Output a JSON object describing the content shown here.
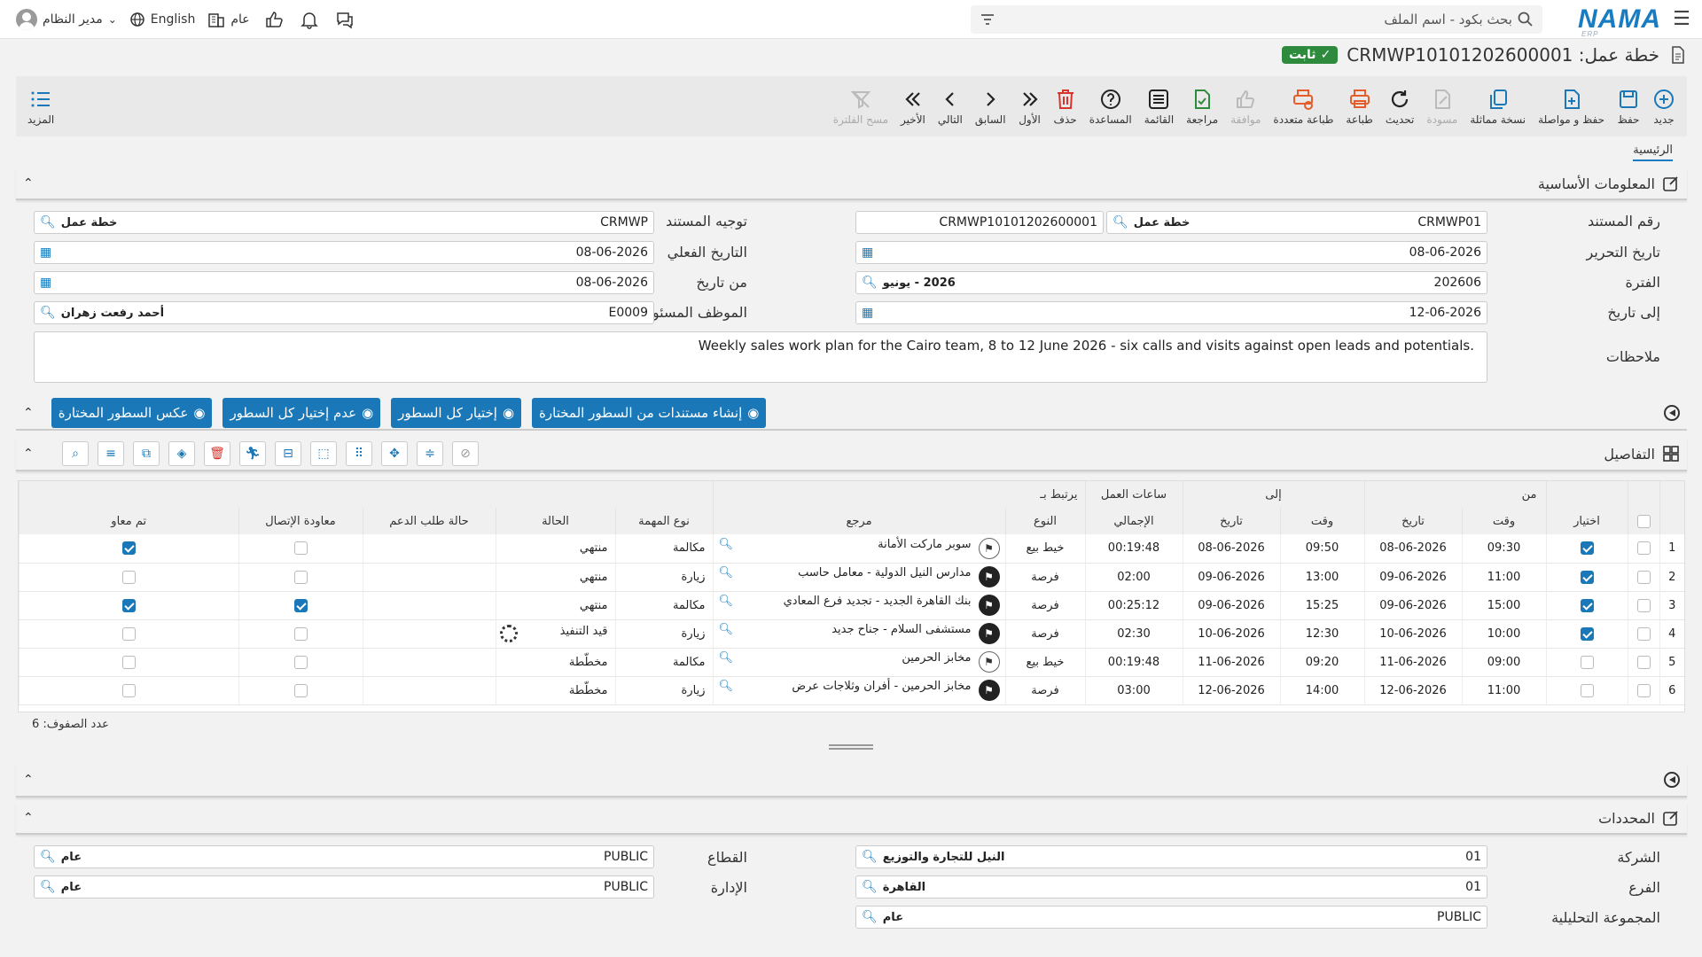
{
  "topbar": {
    "logo": "NAMA",
    "logo_sub": "ERP",
    "search_placeholder": "بحث بكود - اسم الملف",
    "user_name": "مدير النظام",
    "language": "English",
    "scope": "عام"
  },
  "header": {
    "title": "خطة عمل: CRMWP10101202600001",
    "status": "ثابت"
  },
  "toolbar": {
    "buttons": [
      "جديد",
      "حفظ",
      "حفظ و مواصلة",
      "نسخة مماثلة",
      "مسودة",
      "تحديث",
      "طباعة",
      "طباعة متعددة",
      "موافقة",
      "مراجعة",
      "القائمة",
      "المساعدة",
      "حذف",
      "الأول",
      "السابق",
      "التالي",
      "الأخير",
      "مسح الفلترة"
    ],
    "more": "المزيد"
  },
  "tabs": {
    "main": "الرئيسية"
  },
  "basic": {
    "section_title": "المعلومات الأساسية",
    "doc_no_label": "رقم المستند",
    "doc_no": "CRMWP01",
    "doc_no_tag": "خطة عمل",
    "doc_code": "CRMWP10101202600001",
    "doc_dir_label": "توجيه المستند",
    "doc_dir": "CRMWP",
    "doc_dir_tag": "خطة عمل",
    "edit_date_label": "تاريخ التحرير",
    "edit_date": "08-06-2026",
    "actual_date_label": "التاريخ الفعلي",
    "actual_date": "08-06-2026",
    "period_label": "الفترة",
    "period": "202606",
    "period_tag": "2026 - يونيو",
    "from_date_label": "من تاريخ",
    "from_date": "08-06-2026",
    "to_date_label": "إلى تاريخ",
    "to_date": "12-06-2026",
    "employee_label": "الموظف المسئول",
    "employee": "E0009",
    "employee_tag": "أحمد رفعت زهران",
    "notes_label": "ملاحظات",
    "notes": "Weekly sales work plan for the Cairo team, 8 to 12 June 2026 - six calls and visits against open leads and potentials."
  },
  "actions": [
    "إنشاء مستندات من السطور المختارة",
    "إختيار كل السطور",
    "عدم إختيار كل السطور",
    "عكس السطور المختارة"
  ],
  "details": {
    "section_title": "التفاصيل",
    "group_headers": {
      "from": "من",
      "to": "إلى",
      "hours": "ساعات العمل",
      "linked": "يرتبط بـ"
    },
    "columns": [
      "اختيار",
      "وقت",
      "تاريخ",
      "وقت",
      "تاريخ",
      "الإجمالي",
      "النوع",
      "مرجع",
      "نوع المهمة",
      "الحالة",
      "حالة طلب الدعم",
      "معاودة الإتصال",
      "تم معاو"
    ],
    "rows": [
      {
        "n": "1",
        "sel": true,
        "from_time": "09:30",
        "from_date": "08-06-2026",
        "to_time": "09:50",
        "to_date": "08-06-2026",
        "total": "00:19:48",
        "type": "خيط بيع",
        "ref": "سوبر ماركت الأمانة",
        "task": "مكالمة",
        "status": "منتهي",
        "callback": false,
        "done": true,
        "icon": "light"
      },
      {
        "n": "2",
        "sel": true,
        "from_time": "11:00",
        "from_date": "09-06-2026",
        "to_time": "13:00",
        "to_date": "09-06-2026",
        "total": "02:00",
        "type": "فرصة",
        "ref": "مدارس النيل الدولية - معامل حاسب",
        "task": "زيارة",
        "status": "منتهي",
        "callback": false,
        "done": false,
        "icon": "dark"
      },
      {
        "n": "3",
        "sel": true,
        "from_time": "15:00",
        "from_date": "09-06-2026",
        "to_time": "15:25",
        "to_date": "09-06-2026",
        "total": "00:25:12",
        "type": "فرصة",
        "ref": "بنك القاهرة الجديد - تجديد فرع المعادي",
        "task": "مكالمة",
        "status": "منتهي",
        "callback": true,
        "done": true,
        "icon": "dark"
      },
      {
        "n": "4",
        "sel": true,
        "from_time": "10:00",
        "from_date": "10-06-2026",
        "to_time": "12:30",
        "to_date": "10-06-2026",
        "total": "02:30",
        "type": "فرصة",
        "ref": "مستشفى السلام - جناح جديد",
        "task": "زيارة",
        "status": "قيد التنفيذ",
        "callback": false,
        "done": false,
        "icon": "dark",
        "spinner": true
      },
      {
        "n": "5",
        "sel": false,
        "from_time": "09:00",
        "from_date": "11-06-2026",
        "to_time": "09:20",
        "to_date": "11-06-2026",
        "total": "00:19:48",
        "type": "خيط بيع",
        "ref": "مخابز الحرمين",
        "task": "مكالمة",
        "status": "مخطّطة",
        "callback": false,
        "done": false,
        "icon": "light"
      },
      {
        "n": "6",
        "sel": false,
        "from_time": "11:00",
        "from_date": "12-06-2026",
        "to_time": "14:00",
        "to_date": "12-06-2026",
        "total": "03:00",
        "type": "فرصة",
        "ref": "مخابز الحرمين - أفران وثلاجات عرض",
        "task": "زيارة",
        "status": "مخطّطة",
        "callback": false,
        "done": false,
        "icon": "dark"
      }
    ],
    "row_count": "عدد الصفوف: 6"
  },
  "dims": {
    "section_title": "المحددات",
    "company_label": "الشركة",
    "company": "01",
    "company_tag": "النيل للتجارة والتوزيع",
    "branch_label": "الفرع",
    "branch": "01",
    "branch_tag": "القاهرة",
    "group_label": "المجموعة التحليلية",
    "group": "PUBLIC",
    "group_tag": "عام",
    "sector_label": "القطاع",
    "sector": "PUBLIC",
    "sector_tag": "عام",
    "dept_label": "الإدارة",
    "dept": "PUBLIC",
    "dept_tag": "عام"
  }
}
